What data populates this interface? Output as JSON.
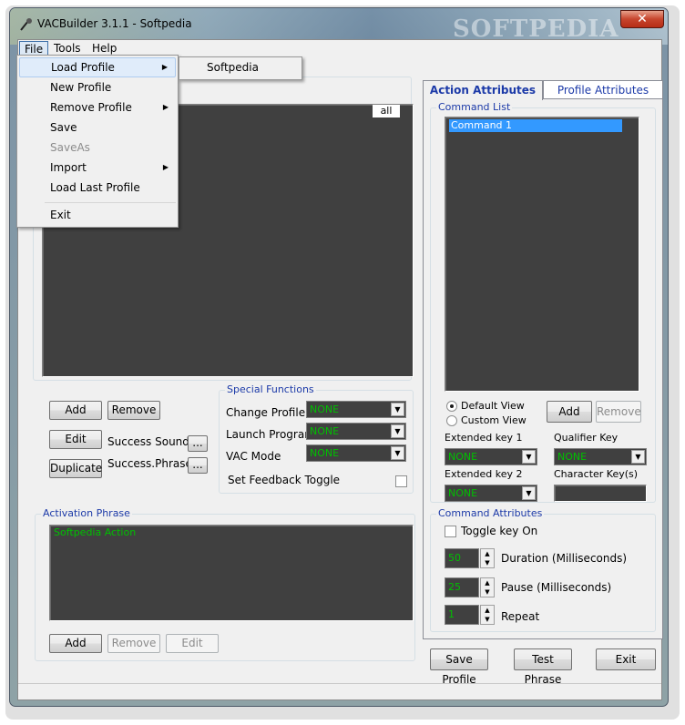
{
  "window": {
    "title": "VACBuilder 3.1.1 - Softpedia",
    "watermark": "SOFTPEDIA",
    "close_glyph": "✕"
  },
  "menubar": {
    "file": "File",
    "tools": "Tools",
    "help": "Help"
  },
  "file_menu": {
    "items": [
      {
        "label": "Load Profile",
        "submenu": true
      },
      {
        "label": "New Profile"
      },
      {
        "label": "Remove Profile",
        "submenu": true
      },
      {
        "label": "Save"
      },
      {
        "label": "SaveAs",
        "disabled": true
      },
      {
        "label": "Import",
        "submenu": true
      },
      {
        "label": "Load Last Profile"
      },
      {
        "label": "Exit"
      }
    ],
    "submenu_item": "Softpedia"
  },
  "left_panel": {
    "list_header_right": "all",
    "buttons": {
      "add": "Add",
      "remove": "Remove",
      "edit": "Edit",
      "duplicate": "Duplicate",
      "ellipsis": "..."
    },
    "success_sound": "Success Sound",
    "success_phrase": "Success.Phrase"
  },
  "special_functions": {
    "title": "Special Functions",
    "change_profile": "Change Profile",
    "launch_program": "Launch Program",
    "vac_mode": "VAC Mode",
    "none": "NONE",
    "feedback_toggle": "Set Feedback Toggle"
  },
  "activation": {
    "title": "Activation Phrase",
    "value": "Softpedia Action",
    "add": "Add",
    "remove": "Remove",
    "edit": "Edit"
  },
  "tabs": {
    "action": "Action Attributes",
    "profile": "Profile Attributes"
  },
  "command_list": {
    "title": "Command List",
    "items": [
      "Command 1"
    ],
    "default_view": "Default View",
    "custom_view": "Custom View",
    "add": "Add",
    "remove": "Remove",
    "extended_key_1": "Extended key 1",
    "extended_key_2": "Extended key 2",
    "qualifier_key": "Qualifier Key",
    "character_keys": "Character Key(s)",
    "none": "NONE"
  },
  "command_attributes": {
    "title": "Command Attributes",
    "toggle_key_on": "Toggle key On",
    "duration_value": "50",
    "duration_label": "Duration (Milliseconds)",
    "pause_value": "25",
    "pause_label": "Pause (Milliseconds)",
    "repeat_value": "1",
    "repeat_label": "Repeat"
  },
  "bottom_buttons": {
    "save_profile": "Save Profile",
    "test_phrase": "Test Phrase",
    "exit": "Exit"
  },
  "colors": {
    "dark_field": "#404040",
    "green_text": "#00c000",
    "group_label": "#1c3aa8",
    "selection": "#3399ff"
  },
  "icons": {
    "submenu_arrow": "▶",
    "combo_arrow": "▼",
    "spin_up": "▲",
    "spin_down": "▼"
  }
}
